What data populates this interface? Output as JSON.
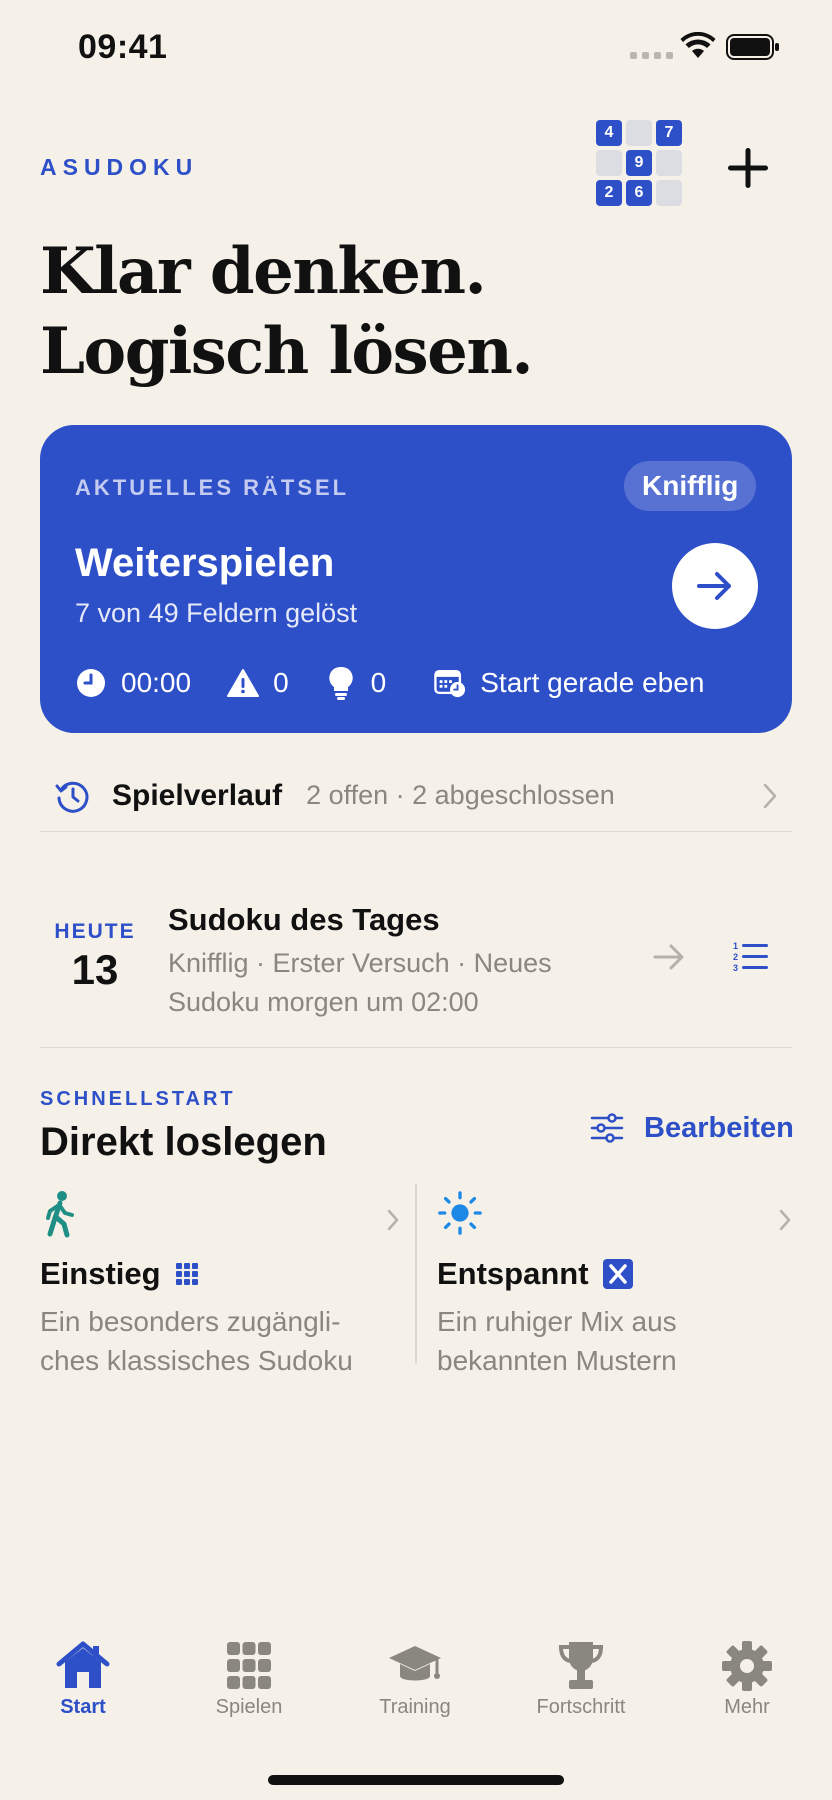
{
  "status": {
    "time": "09:41"
  },
  "brand": "ASUDOKU",
  "logo_cells": [
    "4",
    "",
    "7",
    "",
    "9",
    "",
    "2",
    "6",
    ""
  ],
  "headline": {
    "line1": "Klar denken.",
    "line2": "Logisch lösen."
  },
  "current": {
    "label": "AKTUELLES RÄTSEL",
    "difficulty": "Knifflig",
    "title": "Weiterspielen",
    "progress": "7 von 49 Feldern gelöst",
    "timer": "00:00",
    "mistakes": "0",
    "hints": "0",
    "started": "Start gerade eben"
  },
  "history": {
    "title": "Spielverlauf",
    "summary": "2 offen · 2 abgeschlossen"
  },
  "daily": {
    "today_label": "HEUTE",
    "day": "13",
    "title": "Sudoku des Tages",
    "subtitle": "Knifflig · Erster Versuch · Neues Sudoku morgen um 02:00"
  },
  "quickstart": {
    "label": "SCHNELLSTART",
    "title": "Direkt loslegen",
    "edit": "Bearbeiten",
    "items": [
      {
        "name": "Einstieg",
        "desc": "Ein besonders zugängli-ches klassisches Sudoku",
        "icon": "walking-person-icon"
      },
      {
        "name": "Entspannt",
        "desc": "Ein ruhiger Mix aus bekannten Mustern",
        "icon": "sun-icon"
      }
    ]
  },
  "tabs": [
    {
      "label": "Start",
      "active": true
    },
    {
      "label": "Spielen",
      "active": false
    },
    {
      "label": "Training",
      "active": false
    },
    {
      "label": "Fortschritt",
      "active": false
    },
    {
      "label": "Mehr",
      "active": false
    }
  ],
  "colors": {
    "accent": "#2d4fc8",
    "background": "#f5f1e9",
    "muted": "#8a8680",
    "teal": "#1f8f86",
    "sky": "#1e88e5"
  }
}
